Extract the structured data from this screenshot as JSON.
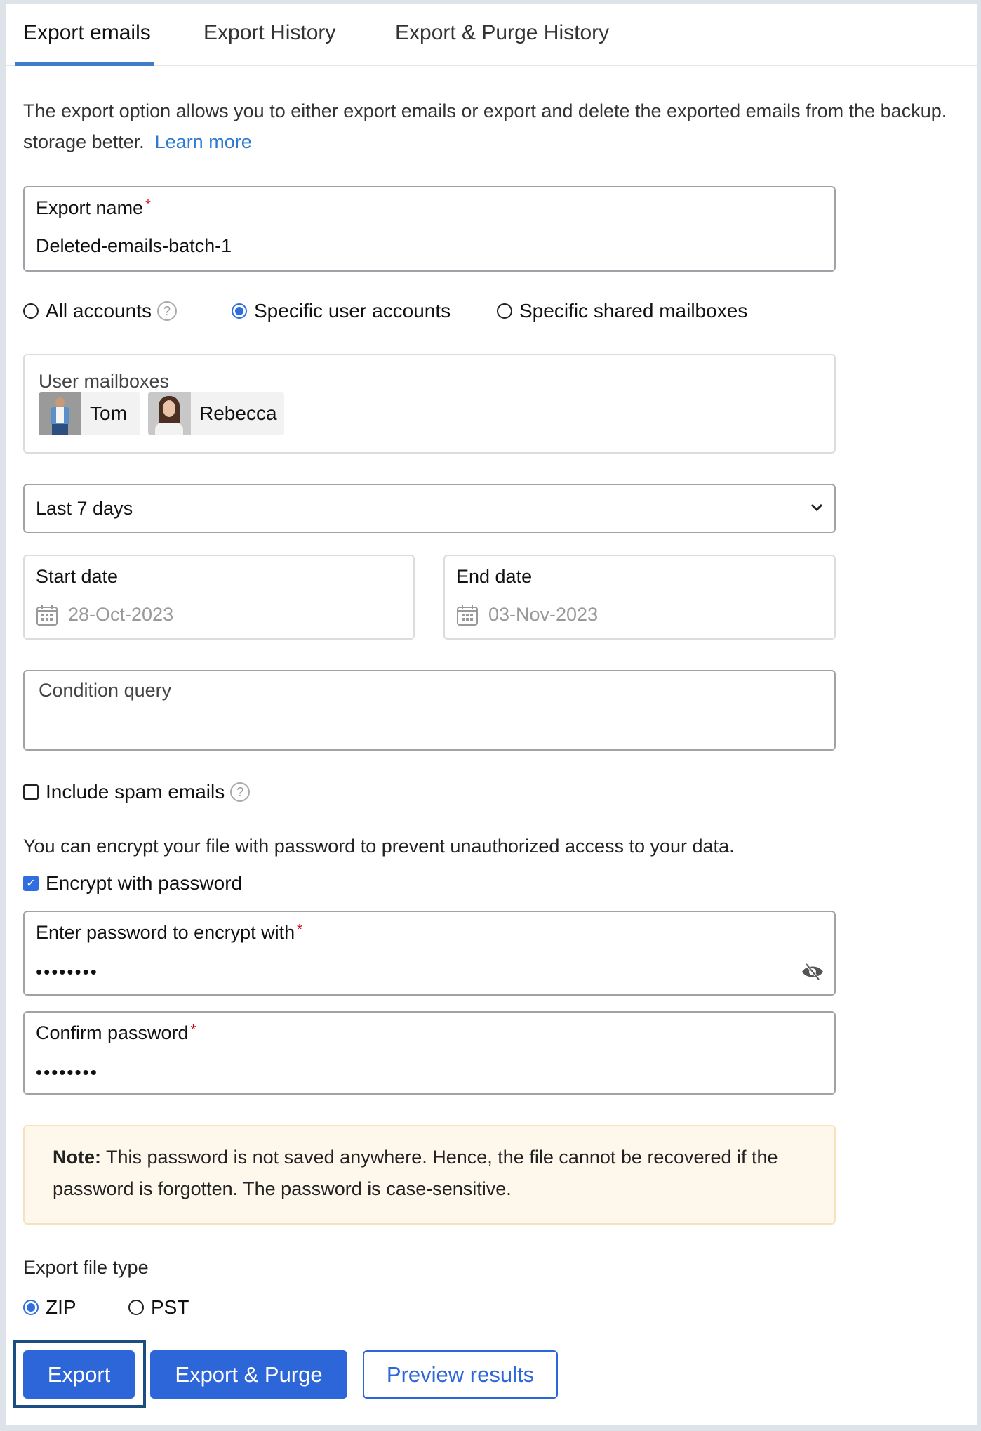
{
  "tabs": [
    {
      "label": "Export emails",
      "active": true
    },
    {
      "label": "Export History",
      "active": false
    },
    {
      "label": "Export & Purge History",
      "active": false
    }
  ],
  "description": {
    "line1": "The export option allows you to either export emails or export and delete the exported emails from the backup.",
    "line2": "storage better.",
    "learn_more": "Learn more"
  },
  "export_name": {
    "label": "Export name",
    "required_mark": "*",
    "value": "Deleted-emails-batch-1"
  },
  "account_scope": {
    "options": [
      {
        "label": "All accounts",
        "selected": false,
        "help": "?"
      },
      {
        "label": "Specific user accounts",
        "selected": true
      },
      {
        "label": "Specific shared mailboxes",
        "selected": false
      }
    ]
  },
  "user_mailboxes": {
    "label": "User mailboxes",
    "users": [
      {
        "name": "Tom"
      },
      {
        "name": "Rebecca"
      }
    ]
  },
  "date_range": {
    "selected": "Last 7 days"
  },
  "start_date": {
    "label": "Start date",
    "value": "28-Oct-2023",
    "icon": "calendar-icon"
  },
  "end_date": {
    "label": "End date",
    "value": "03-Nov-2023",
    "icon": "calendar-icon"
  },
  "condition_query": {
    "placeholder": "Condition query",
    "value": ""
  },
  "include_spam": {
    "label": "Include spam emails",
    "checked": false,
    "help": "?"
  },
  "encrypt": {
    "info": "You can encrypt your file with password to prevent unauthorized access to your data.",
    "label": "Encrypt with password",
    "checked": true
  },
  "password": {
    "label": "Enter password to encrypt with",
    "required_mark": "*",
    "masked_value": "••••••••",
    "toggle_icon": "eye-slash-icon"
  },
  "confirm_password": {
    "label": "Confirm password",
    "required_mark": "*",
    "masked_value": "••••••••"
  },
  "note": {
    "bold": "Note:",
    "text": " This password is not saved anywhere. Hence, the file cannot be recovered if the password is forgotten. The password is case-sensitive."
  },
  "file_type": {
    "label": "Export file type",
    "options": [
      {
        "label": "ZIP",
        "selected": true
      },
      {
        "label": "PST",
        "selected": false
      }
    ]
  },
  "buttons": {
    "export": "Export",
    "export_purge": "Export & Purge",
    "preview": "Preview results"
  },
  "colors": {
    "accent": "#2d66d8",
    "tab_underline": "#3d7dca",
    "link": "#2f7ad1",
    "required": "#d0021b",
    "note_bg": "#fef8ec"
  }
}
